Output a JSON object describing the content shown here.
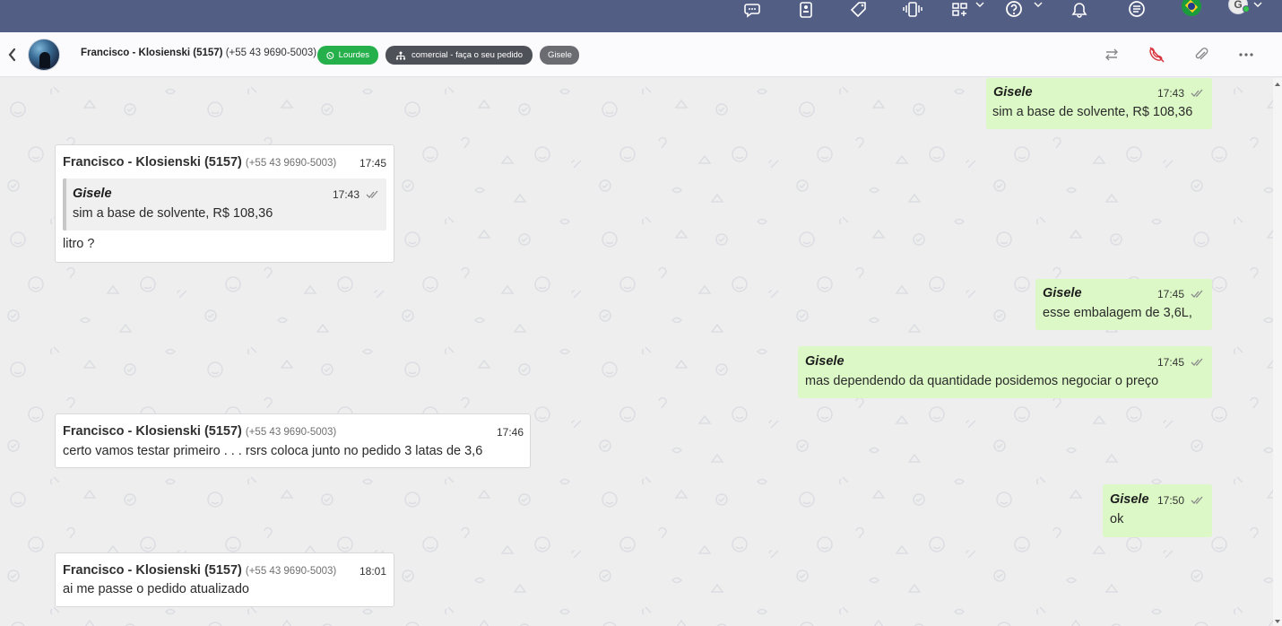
{
  "topbar": {
    "icons": [
      "chat-bubble-icon",
      "id-badge-icon",
      "tag-icon",
      "phone-vibrate-icon",
      "apps-add-icon",
      "help-icon",
      "bell-icon",
      "list-icon",
      "brazil-flag-icon",
      "user-avatar-icon"
    ],
    "avatar_letter": "G"
  },
  "header": {
    "contact_name": "Francisco - Klosienski (5157)",
    "contact_phone": "(+55 43 9690-5003)",
    "tag_whatsapp": "Lourdes",
    "tag_department": "comercial - faça o seu pedido",
    "tag_agent": "Gisele"
  },
  "colors": {
    "topbar": "#535e84",
    "outgoing_bubble": "#dcf8c6",
    "incoming_bubble": "#ffffff",
    "whatsapp_pill": "#25b04b",
    "department_pill": "#4f5159",
    "agent_pill": "#6a6c72",
    "hangup_icon": "#d8343e"
  },
  "messages": [
    {
      "dir": "out",
      "sender": "Gisele",
      "time": "17:43",
      "text": "sim a base de solvente, R$ 108,36"
    },
    {
      "dir": "in",
      "sender": "Francisco - Klosienski (5157)",
      "phone": "(+55 43 9690-5003)",
      "time": "17:45",
      "quote": {
        "sender": "Gisele",
        "time": "17:43",
        "text": "sim a base de solvente, R$ 108,36"
      },
      "text": "litro ?"
    },
    {
      "dir": "out",
      "sender": "Gisele",
      "time": "17:45",
      "text": "esse embalagem de 3,6L,"
    },
    {
      "dir": "out",
      "sender": "Gisele",
      "time": "17:45",
      "text": "mas dependendo da quantidade posidemos negociar o preço"
    },
    {
      "dir": "in",
      "sender": "Francisco - Klosienski (5157)",
      "phone": "(+55 43 9690-5003)",
      "time": "17:46",
      "text": "certo vamos testar primeiro . . . rsrs coloca junto no pedido 3 latas de 3,6"
    },
    {
      "dir": "out",
      "sender": "Gisele",
      "time": "17:50",
      "text": "ok"
    },
    {
      "dir": "in",
      "sender": "Francisco - Klosienski (5157)",
      "phone": "(+55 43 9690-5003)",
      "time": "18:01",
      "text": "ai me passe o pedido atualizado"
    }
  ]
}
